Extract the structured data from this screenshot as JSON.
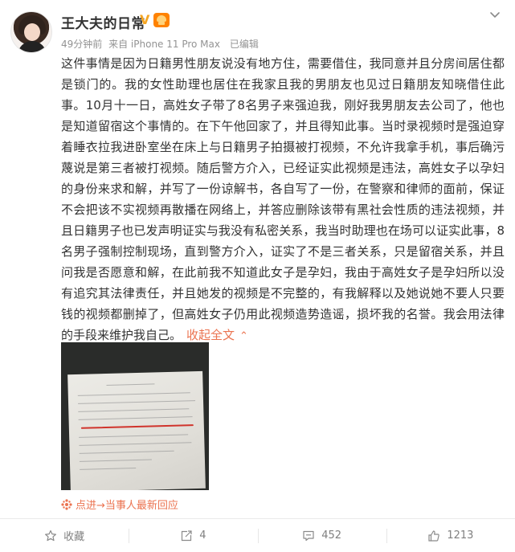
{
  "post": {
    "username": "王大夫的日常",
    "verified_mark": "V",
    "meta": {
      "time": "49分钟前",
      "source": "来自 iPhone 11 Pro Max",
      "edited": "已编辑"
    },
    "text": "这件事情是因为日籍男性朋友说没有地方住，需要借住，我同意并且分房间居住都是锁门的。我的女性助理也居住在我家且我的男朋友也见过日籍朋友知晓借住此事。10月十一日，高姓女子带了8名男子来强迫我，刚好我男朋友去公司了，他也是知道留宿这个事情的。在下午他回家了，并且得知此事。当时录视频时是强迫穿着睡衣拉我进卧室坐在床上与日籍男子拍摄被打视频，不允许我拿手机，事后确污蔑说是第三者被打视频。随后警方介入，已经证实此视频是违法，高姓女子以孕妇的身份来求和解，并写了一份谅解书，各自写了一份，在警察和律师的面前，保证不会把该不实视频再散播在网络上，并答应删除该带有黑社会性质的违法视频，并且日籍男子也已发声明证实与我没有私密关系，我当时助理也在场可以证实此事，8名男子强制控制现场，直到警方介入，证实了不是三者关系，只是留宿关系，并且问我是否愿意和解，在此前我不知道此女子是孕妇，我由于高姓女子是孕妇所以没有追究其法律责任，并且她发的视频是不完整的，有我解释以及她说她不要人只要钱的视频都删掉了，但高姓女子仍用此视频造势造谣，损坏我的名誉。我会用法律的手段来维护我自己。",
    "collapse_label": "收起全文",
    "collapse_arrow": "⌃",
    "repost_link": "点进→当事人最新回应"
  },
  "actions": {
    "favorite": "收藏",
    "repost_count": "4",
    "comment_count": "452",
    "like_count": "1213"
  },
  "icons": {
    "verified": "verified-v-icon",
    "vip": "vip-crown-icon",
    "menu": "chevron-down-icon",
    "favorite": "star-icon",
    "repost": "share-icon",
    "comment": "comment-icon",
    "like": "thumbs-up-icon",
    "repost_link": "sparkle-icon"
  },
  "colors": {
    "accent": "#eb7350",
    "vip": "#ff8200",
    "meta": "#939393"
  }
}
